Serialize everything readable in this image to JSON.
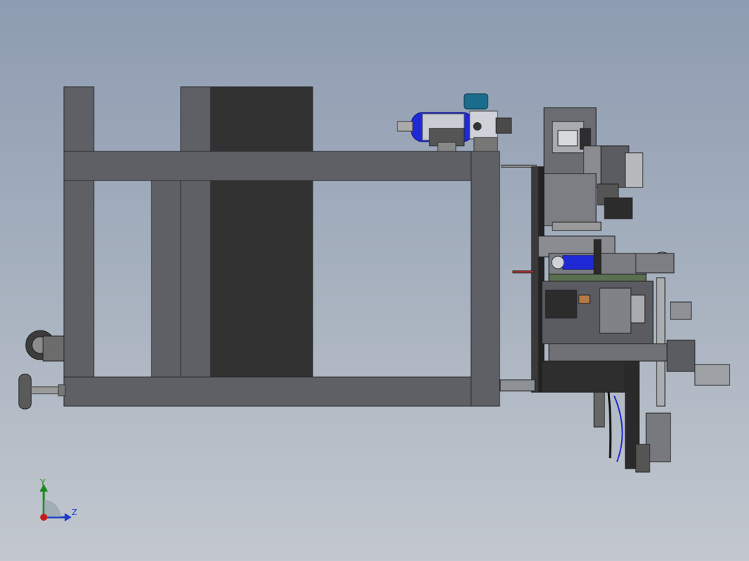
{
  "viewport": {
    "background_top": "#8e9cb1",
    "background_bottom": "#c3c8cf"
  },
  "triad": {
    "y_label": "Y",
    "z_label": "Z",
    "colors": {
      "y": "#1a8a1a",
      "z": "#1a3cc8",
      "x": "#c81a1a"
    }
  },
  "model": {
    "frame_color": "#5d5f64",
    "panel_color": "#323232",
    "accent_blue": "#1f2ad6",
    "accent_teal": "#1a6c8c"
  }
}
